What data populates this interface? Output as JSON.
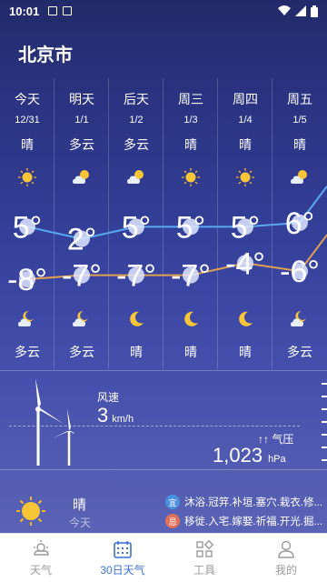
{
  "status": {
    "time": "10:01"
  },
  "city": "北京市",
  "forecast": [
    {
      "day": "今天",
      "date": "12/31",
      "day_cond": "晴",
      "day_icon": "sun-icon",
      "high": "5°",
      "low": "-8°",
      "night_icon": "partly-cloudy-night-icon",
      "night_cond": "多云"
    },
    {
      "day": "明天",
      "date": "1/1",
      "day_cond": "多云",
      "day_icon": "partly-cloudy-icon",
      "high": "2°",
      "low": "-7°",
      "night_icon": "partly-cloudy-night-icon",
      "night_cond": "多云"
    },
    {
      "day": "后天",
      "date": "1/2",
      "day_cond": "多云",
      "day_icon": "partly-cloudy-icon",
      "high": "5°",
      "low": "-7°",
      "night_icon": "moon-icon",
      "night_cond": "晴"
    },
    {
      "day": "周三",
      "date": "1/3",
      "day_cond": "晴",
      "day_icon": "sun-icon",
      "high": "5°",
      "low": "-7°",
      "night_icon": "moon-icon",
      "night_cond": "晴"
    },
    {
      "day": "周四",
      "date": "1/4",
      "day_cond": "晴",
      "day_icon": "sun-icon",
      "high": "5°",
      "low": "-4°",
      "night_icon": "moon-icon",
      "night_cond": "晴"
    },
    {
      "day": "周五",
      "date": "1/5",
      "day_cond": "晴",
      "day_icon": "partly-cloudy-icon",
      "high": "6°",
      "low": "-6°",
      "night_icon": "partly-cloudy-night-icon",
      "night_cond": "多云"
    }
  ],
  "temps": {
    "high_values": [
      5,
      2,
      5,
      5,
      5,
      6
    ],
    "low_values": [
      -8,
      -7,
      -7,
      -7,
      -4,
      -6
    ],
    "high_color": "#5aa8f0",
    "low_color": "#e0a050"
  },
  "wind": {
    "label": "风速",
    "value": "3",
    "unit": "km/h"
  },
  "pressure": {
    "label": "气压",
    "value": "1,023",
    "unit": "hPa"
  },
  "today": {
    "cond": "晴",
    "label": "今天",
    "almanac": [
      {
        "badge": "宜",
        "text": "沐浴.冠笄.补垣.塞穴.栽衣.修...",
        "color": "#4a8fe0"
      },
      {
        "badge": "忌",
        "text": "移徙.入宅.嫁娶.祈福.开光.掘...",
        "color": "#e0705a"
      }
    ]
  },
  "nav": [
    {
      "label": "天气",
      "icon": "weather-icon",
      "active": false
    },
    {
      "label": "30日天气",
      "icon": "calendar-icon",
      "active": true
    },
    {
      "label": "工具",
      "icon": "tools-icon",
      "active": false
    },
    {
      "label": "我的",
      "icon": "profile-icon",
      "active": false
    }
  ]
}
